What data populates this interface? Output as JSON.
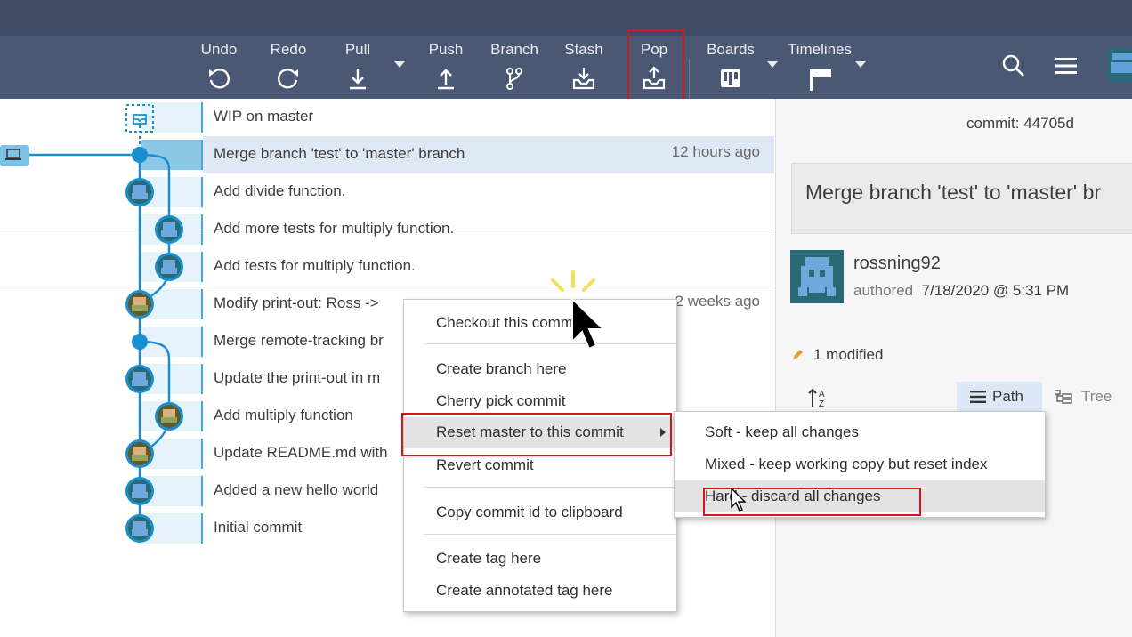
{
  "toolbar": {
    "undo": "Undo",
    "redo": "Redo",
    "pull": "Pull",
    "push": "Push",
    "branch": "Branch",
    "stash": "Stash",
    "pop": "Pop",
    "boards": "Boards",
    "timelines": "Timelines"
  },
  "commits": [
    {
      "message": "WIP on master",
      "time": ""
    },
    {
      "message": "Merge branch 'test' to 'master' branch",
      "time": "12 hours ago"
    },
    {
      "message": "Add divide function.",
      "time": ""
    },
    {
      "message": "Add more tests for multiply function.",
      "time": ""
    },
    {
      "message": "Add tests for multiply function.",
      "time": ""
    },
    {
      "message": "Modify print-out: Ross -> ",
      "time": "2 weeks ago"
    },
    {
      "message": "Merge remote-tracking br",
      "time": ""
    },
    {
      "message": "Update the print-out in m",
      "time": ""
    },
    {
      "message": "Add multiply function",
      "time": ""
    },
    {
      "message": "Update README.md with",
      "time": ""
    },
    {
      "message": "Added a new hello world",
      "time": ""
    },
    {
      "message": "Initial commit",
      "time": ""
    }
  ],
  "detail": {
    "commit_label": "commit: 44705d",
    "message": "Merge branch 'test' to 'master' br",
    "author": "rossning92",
    "authored_label": "authored",
    "authored_date": "7/18/2020 @ 5:31 PM",
    "modified": "1 modified",
    "path_label": "Path",
    "tree_label": "Tree"
  },
  "context_menu": {
    "checkout": "Checkout this commit",
    "create_branch": "Create branch here",
    "cherry_pick": "Cherry pick commit",
    "reset": "Reset master to this commit",
    "revert": "Revert commit",
    "copy_id": "Copy commit id to clipboard",
    "create_tag": "Create tag here",
    "create_annotated_tag": "Create annotated tag here"
  },
  "reset_submenu": {
    "soft": "Soft - keep all changes",
    "mixed": "Mixed - keep working copy but reset index",
    "hard": "Hard - discard all changes"
  },
  "colors": {
    "toolbar_bg": "#4a5874",
    "graph_line": "#1a8fd0",
    "highlight": "#d9141b"
  }
}
